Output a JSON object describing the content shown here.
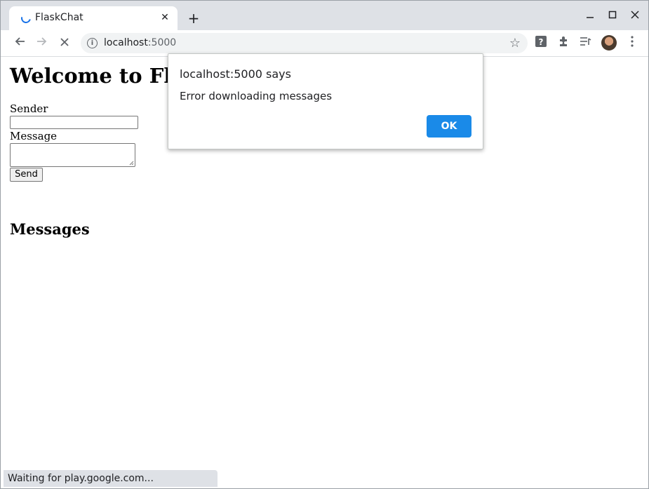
{
  "browser": {
    "tab_title": "FlaskChat",
    "tab_close": "✕",
    "new_tab": "+",
    "url_host": "localhost",
    "url_port": ":5000",
    "status_text": "Waiting for play.google.com..."
  },
  "page": {
    "heading": "Welcome to FlaskChat",
    "sender_label": "Sender",
    "message_label": "Message",
    "send_button": "Send",
    "messages_heading": "Messages"
  },
  "dialog": {
    "title": "localhost:5000 says",
    "message": "Error downloading messages",
    "ok_button": "OK"
  },
  "colors": {
    "accent": "#1a8ae8",
    "tab_strip": "#dee1e6"
  }
}
